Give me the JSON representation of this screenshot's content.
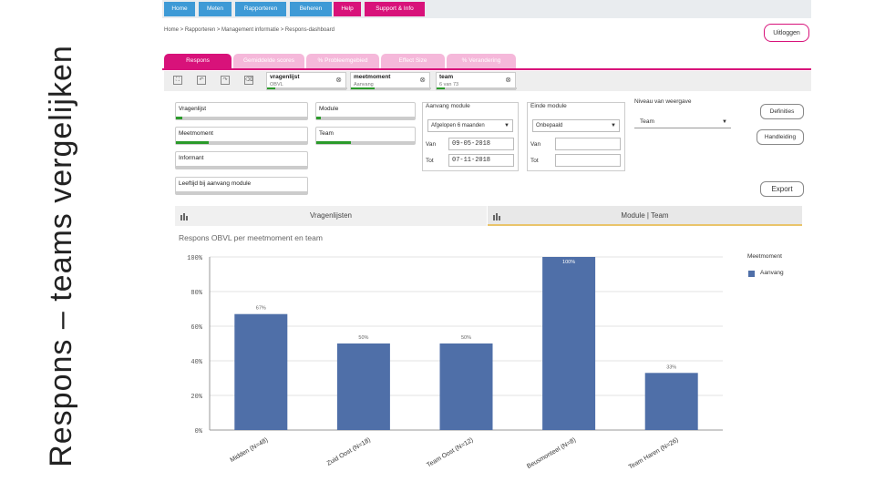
{
  "slide_title": "Respons – teams vergelijken",
  "topnav": [
    {
      "label": "Home",
      "color": "#3e9ad6"
    },
    {
      "label": "Meten",
      "color": "#3e9ad6"
    },
    {
      "label": "Rapporteren",
      "color": "#3e9ad6"
    },
    {
      "label": "Beheren",
      "color": "#3e9ad6"
    },
    {
      "label": "Help",
      "color": "#d8127a"
    },
    {
      "label": "Support & Info",
      "color": "#d8127a"
    }
  ],
  "logout_label": "Uitloggen",
  "breadcrumb": "Home  >  Rapporteren  >  Management informatie  >  Respons-dashboard",
  "tabs": [
    {
      "label": "Respons",
      "active": true
    },
    {
      "label": "Gemiddelde scores",
      "active": false
    },
    {
      "label": "% Probleemgebied",
      "active": false
    },
    {
      "label": "Effect Size",
      "active": false
    },
    {
      "label": "% Verandering",
      "active": false
    }
  ],
  "filter_chips": [
    {
      "label": "vragenlijst",
      "value": "OBVL",
      "fill": 0.1
    },
    {
      "label": "meetmoment",
      "value": "Aanvang",
      "fill": 0.3
    },
    {
      "label": "team",
      "value": "6 van 73",
      "fill": 0.1
    }
  ],
  "filter_boxes": [
    {
      "label": "Vragenlijst",
      "fill": 0.05
    },
    {
      "label": "Meetmoment",
      "fill": 0.25
    },
    {
      "label": "Informant",
      "fill": 0
    },
    {
      "label": "Leeftijd bij aanvang module",
      "fill": 0
    },
    {
      "label": "Module",
      "fill": 0.05
    },
    {
      "label": "Team",
      "fill": 0.35
    }
  ],
  "aanvang_module": {
    "label": "Aanvang module",
    "select": "Afgelopen 6 maanden",
    "van_label": "Van",
    "van_value": "09-05-2018",
    "tot_label": "Tot",
    "tot_value": "07-11-2018"
  },
  "einde_module": {
    "label": "Einde module",
    "select": "Onbepaald",
    "van_label": "Van",
    "van_value": "",
    "tot_label": "Tot",
    "tot_value": ""
  },
  "niveau": {
    "label": "Niveau van weergave",
    "value": "Team"
  },
  "buttons": {
    "definities": "Definities",
    "handleiding": "Handleiding",
    "export": "Export"
  },
  "panels": {
    "left": "Vragenlijsten",
    "right": "Module | Team"
  },
  "chart_data": {
    "type": "bar",
    "title": "Respons OBVL per meetmoment en team",
    "categories": [
      "Midden (N=48)",
      "Zuid Oost (N=18)",
      "Team Oost (N=12)",
      "Beusmonteel (N=8)",
      "Team Haren (N=26)"
    ],
    "series": [
      {
        "name": "Aanvang",
        "values": [
          67,
          50,
          50,
          100,
          33
        ],
        "color": "#4f6fa8"
      }
    ],
    "data_labels": [
      "67%",
      "50%",
      "50%",
      "100%",
      "33%"
    ],
    "y_ticks": [
      "0%",
      "20%",
      "40%",
      "60%",
      "80%",
      "100%"
    ],
    "ylim": [
      0,
      100
    ],
    "legend_title": "Meetmoment",
    "legend_position": "top-right",
    "grid": true
  }
}
